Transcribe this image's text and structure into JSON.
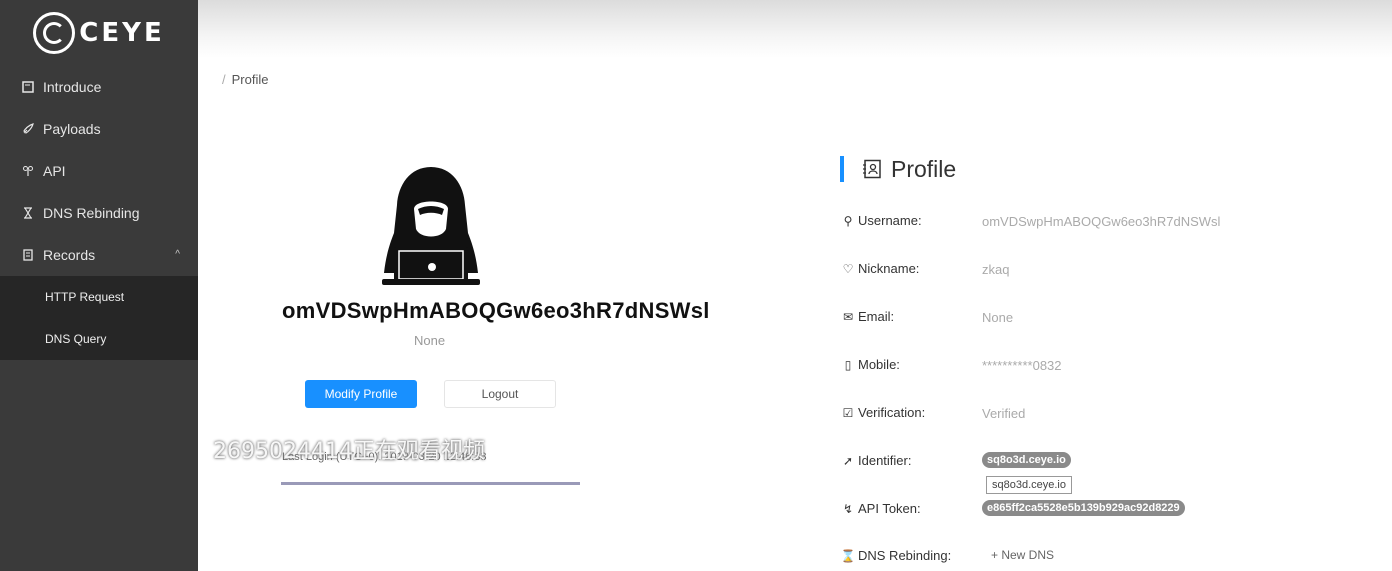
{
  "brand": {
    "logo_text": "CEYE"
  },
  "sidebar": {
    "items": [
      {
        "label": "Introduce",
        "icon": "document-icon"
      },
      {
        "label": "Payloads",
        "icon": "rocket-icon"
      },
      {
        "label": "API",
        "icon": "api-icon"
      },
      {
        "label": "DNS Rebinding",
        "icon": "hourglass-icon"
      },
      {
        "label": "Records",
        "icon": "records-icon"
      }
    ],
    "subitems": [
      {
        "label": "HTTP Request"
      },
      {
        "label": "DNS Query"
      }
    ]
  },
  "breadcrumb": {
    "sep": "/",
    "current": "Profile"
  },
  "profile_card": {
    "username": "omVDSwpHmABOQGw6eo3hR7dNSWsl",
    "nickname": "None",
    "modify_label": "Modify Profile",
    "logout_label": "Logout",
    "last_login": "Last Login (UTC+0): 2019-03-20 12:46:33",
    "overlay": "2695024414正在观看视频"
  },
  "panel": {
    "title": "Profile",
    "rows": {
      "username": {
        "label": "Username:",
        "value": "omVDSwpHmABOQGw6eo3hR7dNSWsl"
      },
      "nickname": {
        "label": "Nickname:",
        "value": "zkaq"
      },
      "email": {
        "label": "Email:",
        "value": "None"
      },
      "mobile": {
        "label": "Mobile:",
        "value": "**********0832"
      },
      "verification": {
        "label": "Verification:",
        "value": "Verified"
      },
      "identifier": {
        "label": "Identifier:",
        "value": "sq8o3d.ceye.io",
        "tooltip": "sq8o3d.ceye.io"
      },
      "api_token": {
        "label": "API Token:",
        "value": "e865ff2ca5528e5b139b929ac92d8229"
      },
      "dns_rebinding": {
        "label": "DNS Rebinding:",
        "action": "+ New DNS"
      }
    }
  },
  "colors": {
    "sidebar": "#3a3a3a",
    "submenu": "#262626",
    "primary": "#1890ff"
  }
}
